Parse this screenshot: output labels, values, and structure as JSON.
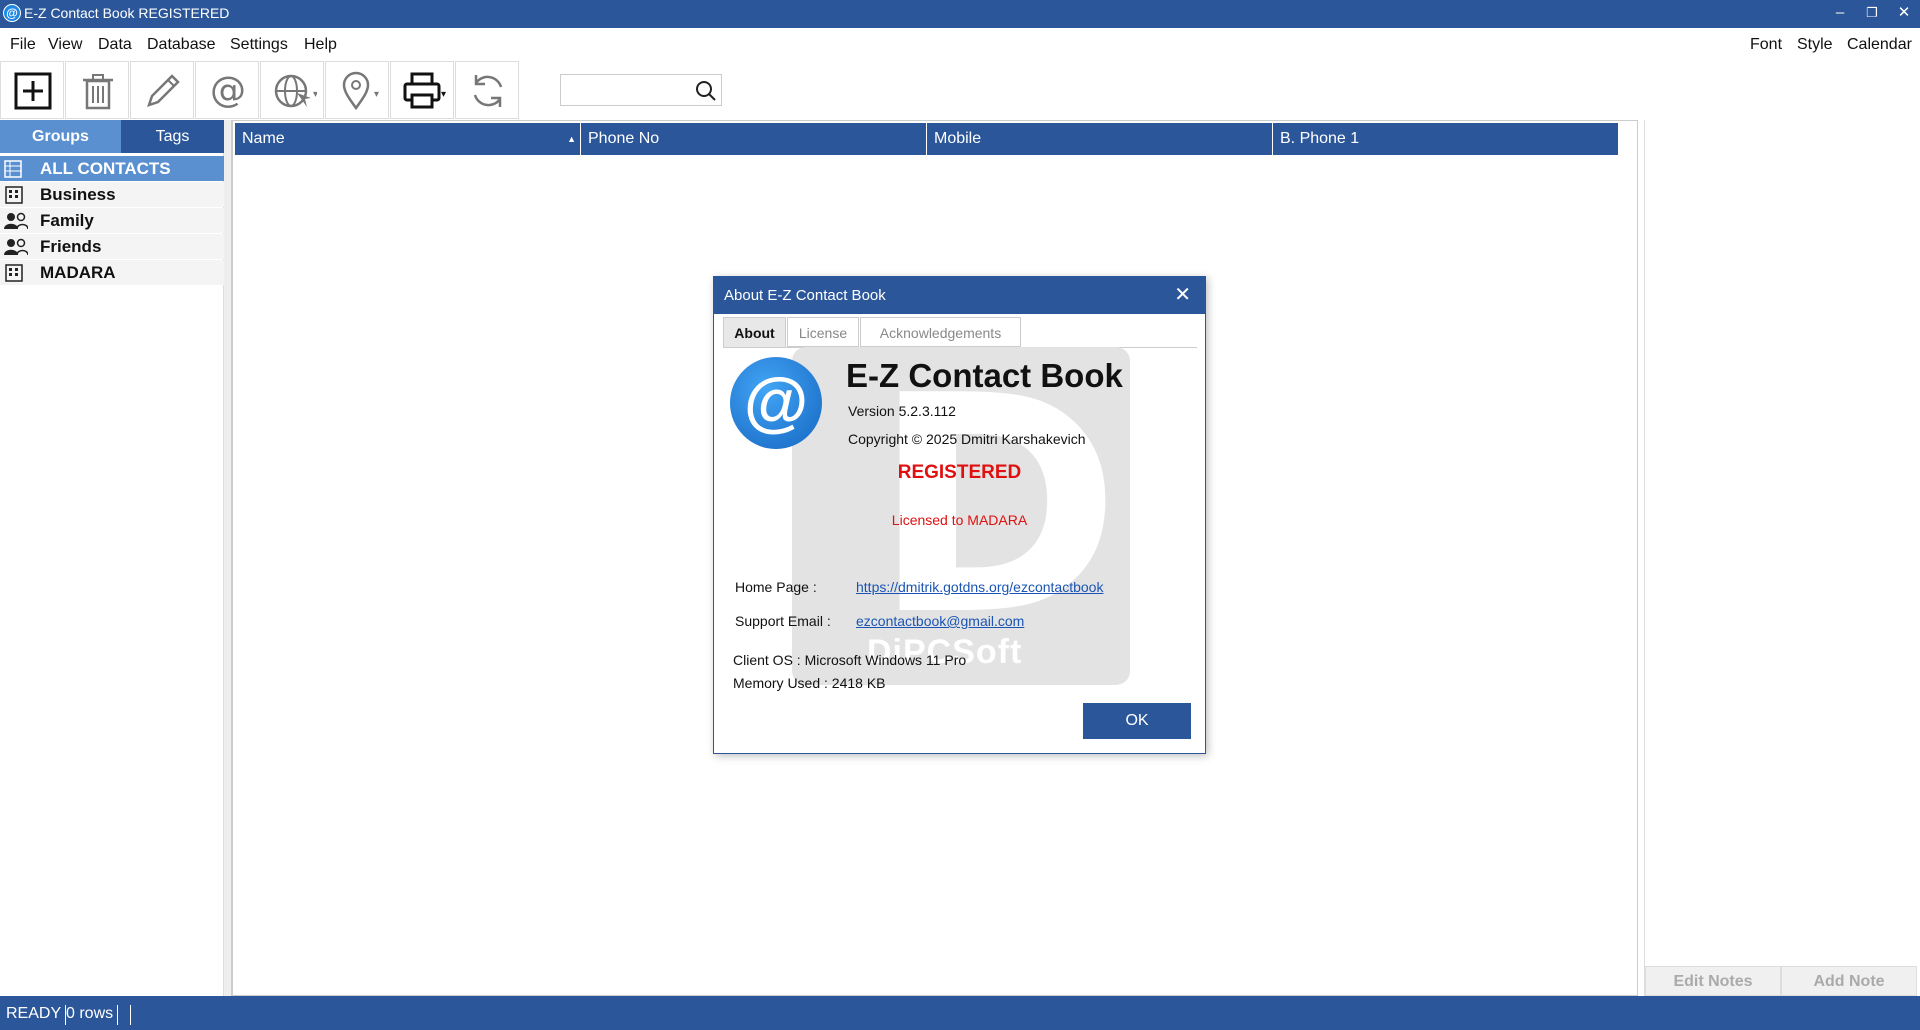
{
  "window": {
    "title": "E-Z Contact Book REGISTERED"
  },
  "menu": {
    "items": [
      "File",
      "View",
      "Data",
      "Database",
      "Settings",
      "Help"
    ],
    "right_items": [
      "Font",
      "Style",
      "Calendar"
    ]
  },
  "toolbar": {
    "buttons": [
      "add-contact",
      "delete",
      "edit",
      "email",
      "web",
      "map",
      "print",
      "refresh"
    ],
    "search_placeholder": ""
  },
  "sidebar": {
    "tabs": {
      "groups": "Groups",
      "tags": "Tags"
    },
    "groups": [
      {
        "label": "ALL CONTACTS",
        "icon": "list-icon",
        "selected": true
      },
      {
        "label": "Business",
        "icon": "building-icon"
      },
      {
        "label": "Family",
        "icon": "people-icon"
      },
      {
        "label": "Friends",
        "icon": "people-icon"
      },
      {
        "label": "MADARA",
        "icon": "building-icon"
      }
    ]
  },
  "grid": {
    "columns": [
      "Name",
      "Phone No",
      "Mobile",
      "B. Phone 1"
    ]
  },
  "notes": {
    "edit_label": "Edit Notes",
    "add_label": "Add Note"
  },
  "status": {
    "state": "READY",
    "rows": "0 rows"
  },
  "dialog": {
    "title": "About E-Z Contact Book",
    "tabs": [
      "About",
      "License",
      "Acknowledgements"
    ],
    "product": "E-Z Contact Book",
    "version": "Version 5.2.3.112",
    "copyright": "Copyright © 2025 Dmitri Karshakevich",
    "registered": "REGISTERED",
    "licensed_to": "Licensed to MADARA",
    "home_label": "Home Page :",
    "home_url": "https://dmitrik.gotdns.org/ezcontactbook",
    "support_label": "Support Email :",
    "support_email": "ezcontactbook@gmail.com",
    "client_os": "Client OS : Microsoft Windows 11 Pro",
    "memory": "Memory Used : 2418 KB",
    "ok_label": "OK",
    "watermark": "DiPCSoft"
  },
  "colors": {
    "accent": "#2b579a",
    "selected": "#5a8fd0",
    "registered": "#e01010"
  }
}
